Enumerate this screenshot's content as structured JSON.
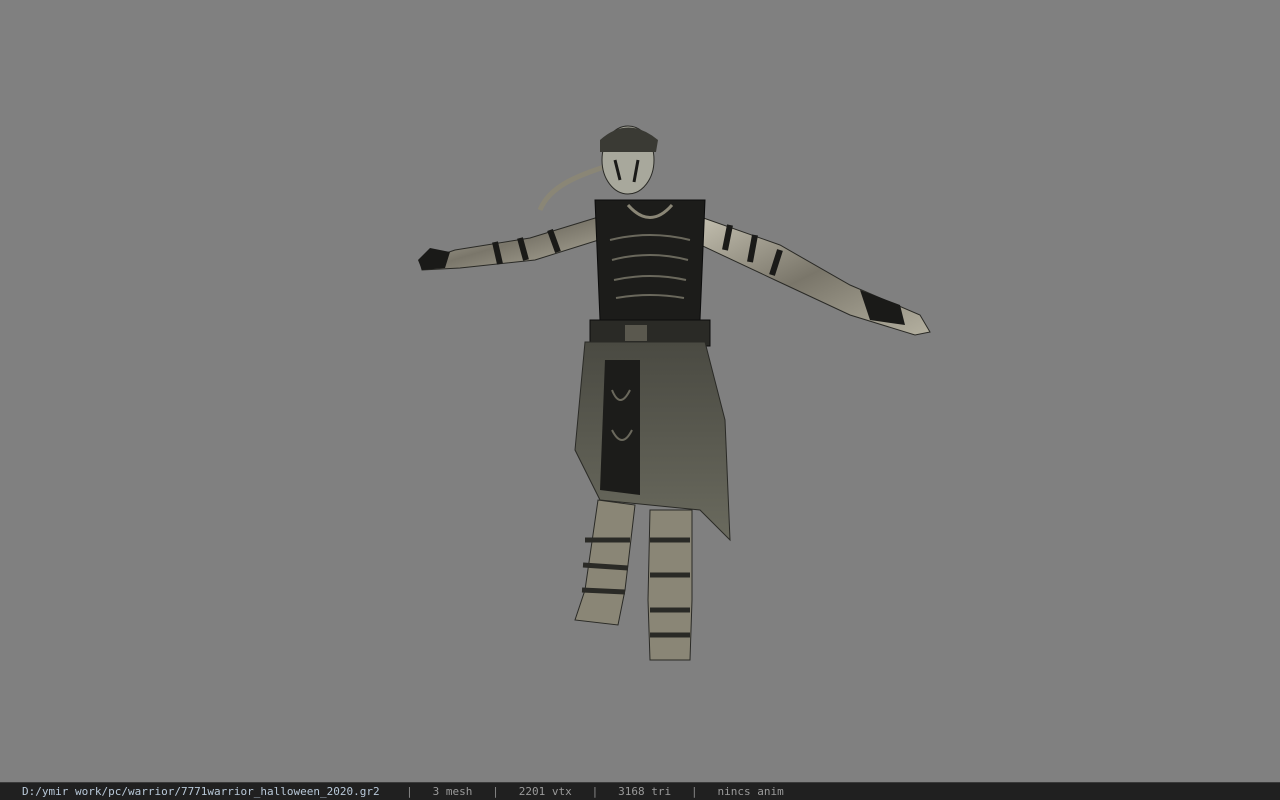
{
  "status": {
    "file_path": "D:/ymir work/pc/warrior/7771warrior_halloween_2020.gr2",
    "separator": "|",
    "mesh": "3 mesh",
    "vtx": "2201 vtx",
    "tri": "3168 tri",
    "anim": "nincs anim"
  },
  "colors": {
    "viewport_bg": "#808080",
    "statusbar_bg": "#202020"
  }
}
